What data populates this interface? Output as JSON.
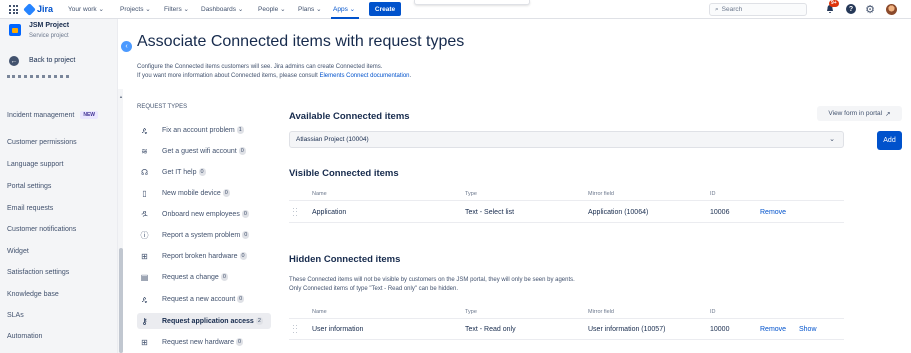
{
  "topnav": {
    "brand": "Jira",
    "items": [
      "Your work",
      "Projects",
      "Filters",
      "Dashboards",
      "People",
      "Plans",
      "Apps"
    ],
    "create": "Create",
    "search_placeholder": "Search",
    "notifications_badge": "9+",
    "help": "?"
  },
  "sidebar": {
    "project_name": "JSM Project",
    "project_type": "Service project",
    "back": "Back to project",
    "items": [
      "Incident management",
      "Customer permissions",
      "Language support",
      "Portal settings",
      "Email requests",
      "Customer notifications",
      "Widget",
      "Satisfaction settings",
      "Knowledge base",
      "SLAs",
      "Automation"
    ],
    "new_badge": "NEW"
  },
  "page": {
    "title": "Associate Connected items with request types",
    "desc1": "Configure the Connected items customers will see. Jira admins can create Connected items.",
    "desc2_prefix": "If you want more information about Connected items, please consult ",
    "desc2_link": "Elements Connect documentation",
    "desc2_suffix": "."
  },
  "request_types": {
    "heading": "REQUEST TYPES",
    "items": [
      {
        "icon": "account-icon",
        "label": "Fix an account problem",
        "count": "1"
      },
      {
        "icon": "wifi-icon",
        "label": "Get a guest wifi account",
        "count": "0"
      },
      {
        "icon": "headset-icon",
        "label": "Get IT help",
        "count": "0"
      },
      {
        "icon": "mobile-icon",
        "label": "New mobile device",
        "count": "0"
      },
      {
        "icon": "people-icon",
        "label": "Onboard new employees",
        "count": "0"
      },
      {
        "icon": "info-icon",
        "label": "Report a system problem",
        "count": "0"
      },
      {
        "icon": "hardware-icon",
        "label": "Report broken hardware",
        "count": "0"
      },
      {
        "icon": "document-icon",
        "label": "Request a change",
        "count": "0"
      },
      {
        "icon": "account-icon",
        "label": "Request a new account",
        "count": "0"
      },
      {
        "icon": "key-icon",
        "label": "Request application access",
        "count": "2"
      },
      {
        "icon": "hardware-icon",
        "label": "Request new hardware",
        "count": "0"
      }
    ]
  },
  "available": {
    "title": "Available Connected items",
    "view_portal": "View form in portal",
    "select_value": "Atlassian Project (10004)",
    "add": "Add"
  },
  "columns": {
    "name": "Name",
    "type": "Type",
    "mirror": "Mirror field",
    "id": "ID"
  },
  "visible": {
    "title": "Visible Connected items",
    "rows": [
      {
        "name": "Application",
        "type": "Text - Select list",
        "mirror": "Application (10064)",
        "id": "10006",
        "action1": "Remove"
      }
    ]
  },
  "hidden": {
    "title": "Hidden Connected items",
    "desc1": "These Connected items will not be visible by customers on the JSM portal, they will only be seen by agents.",
    "desc2": "Only Connected items of type \"Text - Read only\" can be hidden.",
    "rows": [
      {
        "name": "User information",
        "type": "Text - Read only",
        "mirror": "User information (10057)",
        "id": "10000",
        "action1": "Remove",
        "action2": "Show"
      }
    ]
  },
  "colors": {
    "primary": "#0052cc",
    "sidebar_bg": "#f4f5f7",
    "text": "#172b4d",
    "subtle": "#42526e"
  }
}
